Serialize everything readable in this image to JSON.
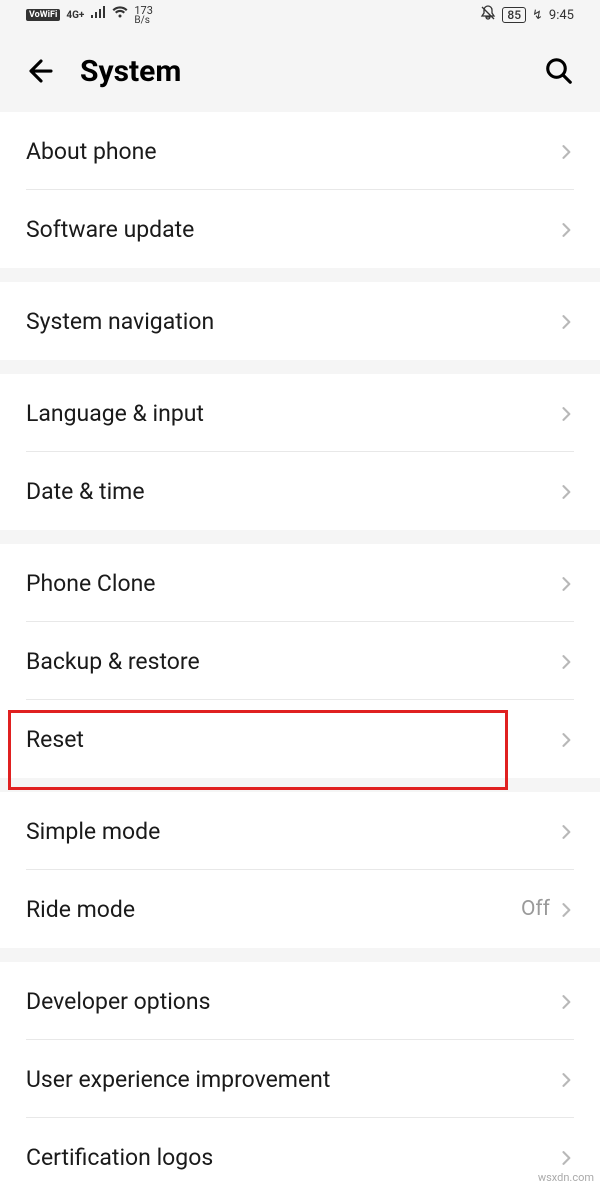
{
  "status_bar": {
    "vowifi": "VoWiFi",
    "network": "4G+",
    "data_rate_value": "173",
    "data_rate_unit": "B/s",
    "battery": "85",
    "time": "9:45"
  },
  "header": {
    "title": "System"
  },
  "groups": [
    {
      "rows": [
        {
          "key": "about-phone",
          "label": "About phone",
          "value": ""
        },
        {
          "key": "software-update",
          "label": "Software update",
          "value": ""
        }
      ]
    },
    {
      "rows": [
        {
          "key": "system-navigation",
          "label": "System navigation",
          "value": ""
        }
      ]
    },
    {
      "rows": [
        {
          "key": "language-input",
          "label": "Language & input",
          "value": ""
        },
        {
          "key": "date-time",
          "label": "Date & time",
          "value": ""
        }
      ]
    },
    {
      "rows": [
        {
          "key": "phone-clone",
          "label": "Phone Clone",
          "value": ""
        },
        {
          "key": "backup-restore",
          "label": "Backup & restore",
          "value": ""
        },
        {
          "key": "reset",
          "label": "Reset",
          "value": "",
          "highlighted": true
        }
      ]
    },
    {
      "rows": [
        {
          "key": "simple-mode",
          "label": "Simple mode",
          "value": ""
        },
        {
          "key": "ride-mode",
          "label": "Ride mode",
          "value": "Off"
        }
      ]
    },
    {
      "rows": [
        {
          "key": "developer-options",
          "label": "Developer options",
          "value": ""
        },
        {
          "key": "user-experience",
          "label": "User experience improvement",
          "value": ""
        },
        {
          "key": "certification-logos",
          "label": "Certification logos",
          "value": ""
        }
      ]
    }
  ],
  "watermark": "wsxdn.com"
}
